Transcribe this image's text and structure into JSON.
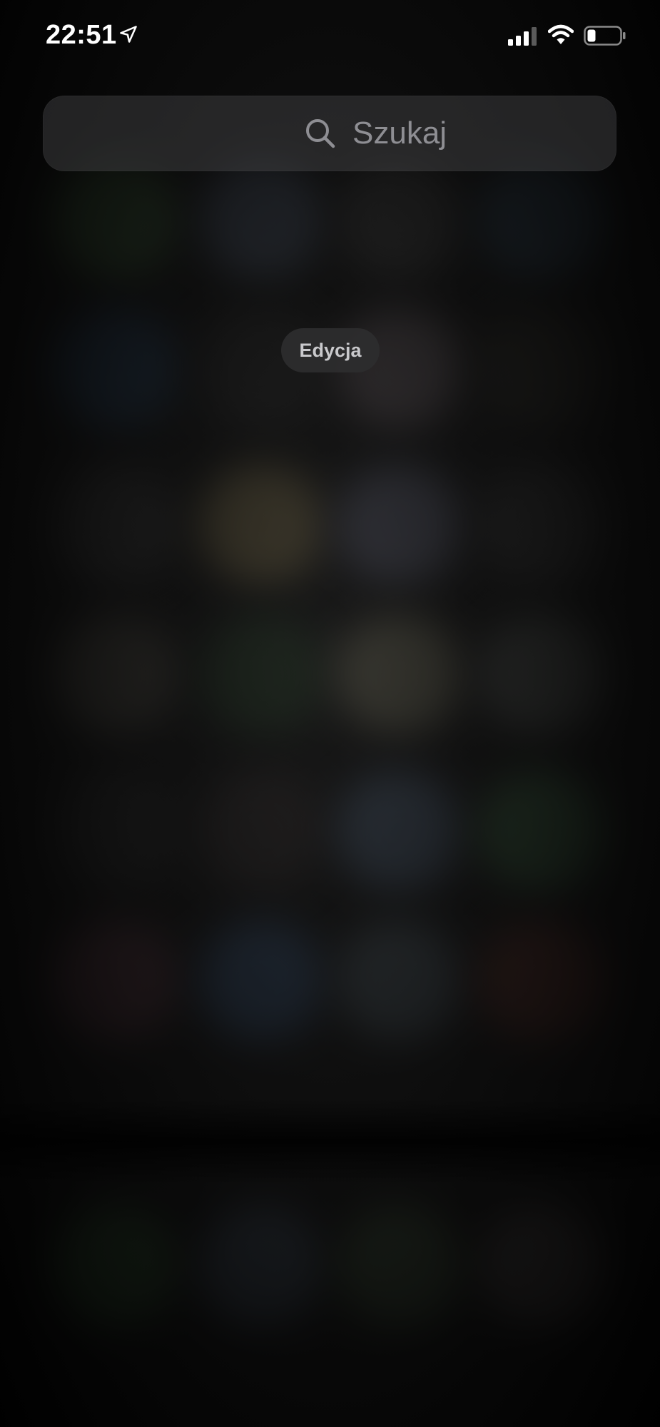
{
  "status_bar": {
    "time": "22:51",
    "icons": [
      "location-arrow-icon",
      "cellular-signal-icon",
      "wifi-icon",
      "battery-icon"
    ]
  },
  "search": {
    "placeholder": "Szukaj",
    "icon": "search-icon"
  },
  "edit_button": {
    "label": "Edycja"
  },
  "colors": {
    "background": "#060606",
    "text_primary": "#ffffff",
    "search_placeholder": "#8e8e93",
    "pill_bg": "#2d2d2f",
    "pill_text": "#c9c9cc"
  }
}
